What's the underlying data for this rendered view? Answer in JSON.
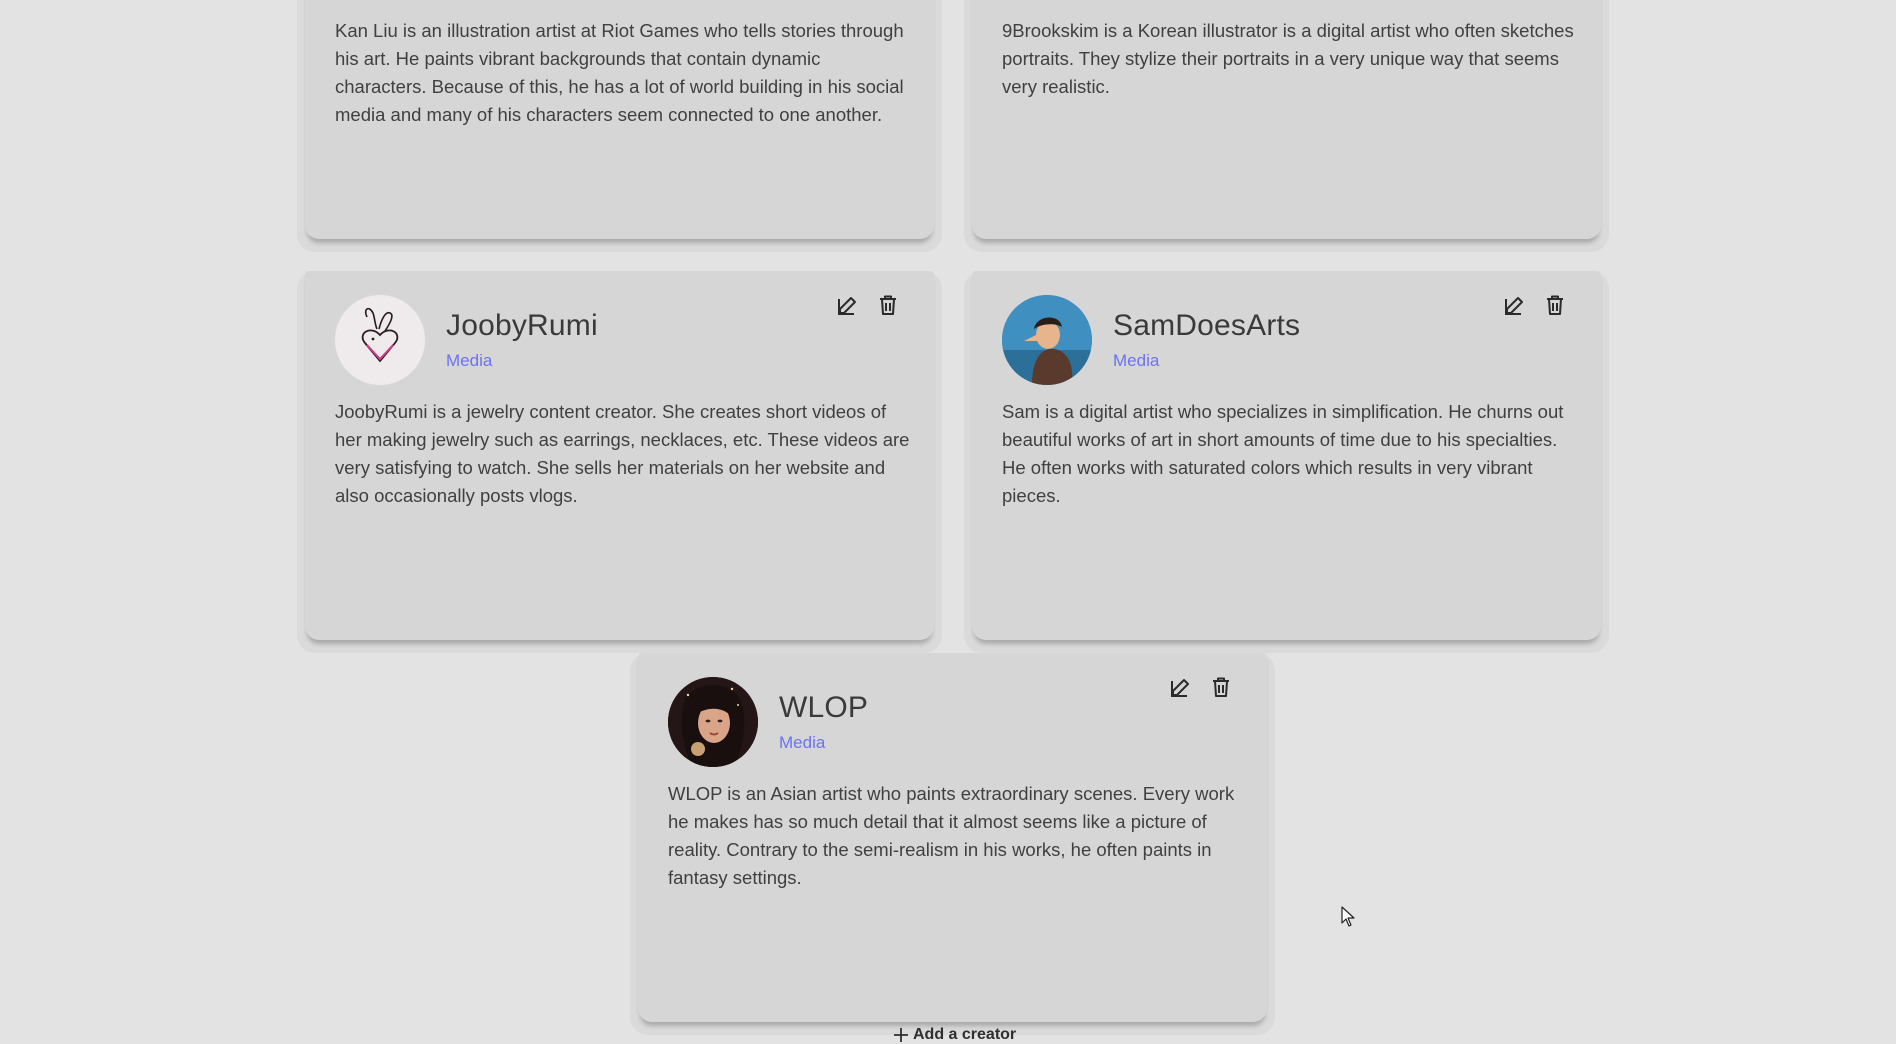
{
  "cards": [
    {
      "name": "",
      "category": "",
      "description": "Kan Liu is an illustration artist at Riot Games who tells stories through his art. He paints vibrant backgrounds that contain dynamic characters. Because of this, he has a lot of world building in his social media and many of his characters seem connected to one another."
    },
    {
      "name": "",
      "category": "",
      "description": "9Brookskim is a Korean illustrator is a digital artist who often sketches portraits. They stylize their portraits in a very unique way that seems very realistic."
    },
    {
      "name": "JoobyRumi",
      "category": "Media",
      "description": "JoobyRumi is a jewelry content creator. She creates short videos of her making jewelry such as earrings, necklaces, etc. These videos are very satisfying to watch. She sells her materials on her website and also occasionally posts vlogs."
    },
    {
      "name": "SamDoesArts",
      "category": "Media",
      "description": "Sam is a digital artist who specializes in simplification. He churns out beautiful works of art in short amounts of time due to his specialties. He often works with saturated colors which results in very vibrant pieces."
    },
    {
      "name": "WLOP",
      "category": "Media",
      "description": "WLOP is an Asian artist who paints extraordinary scenes. Every work he makes has so much detail that it almost seems like a picture of reality. Contrary to the semi-realism in his works, he often paints in fantasy settings."
    }
  ],
  "add_creator": {
    "label": "Add a creator"
  },
  "colors": {
    "background": "#e3e3e3",
    "card": "#d6d6d6",
    "category_accent": "#6b73f0"
  },
  "icons": {
    "edit": "pencil-square-icon",
    "delete": "trash-icon",
    "add": "plus-icon"
  }
}
